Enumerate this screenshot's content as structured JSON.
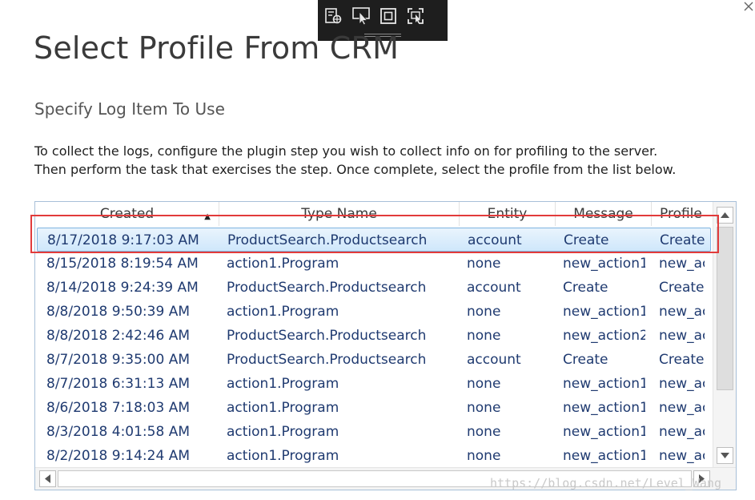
{
  "dialog": {
    "title": "Select Profile From CRM",
    "subtitle": "Specify Log Item To Use",
    "instructions": [
      "To collect the logs, configure the plugin step you wish to collect info on for profiling to the server.",
      "Then perform the task that exercises the step. Once complete, select the profile from the list below."
    ]
  },
  "toolbar": {
    "icons": [
      "select-element-icon",
      "pointer-icon",
      "frame-icon",
      "region-capture-icon"
    ]
  },
  "table": {
    "columns": [
      "Created",
      "Type Name",
      "Entity",
      "Message",
      "Profile"
    ],
    "sort": {
      "column": "Created",
      "direction": "ascending-arrow"
    },
    "selected_row": 0,
    "rows": [
      [
        "8/17/2018 9:17:03 AM",
        "ProductSearch.Productsearch",
        "account",
        "Create",
        "Create"
      ],
      [
        "8/15/2018 8:19:54 AM",
        "action1.Program",
        "none",
        "new_action1",
        "new_ac"
      ],
      [
        "8/14/2018 9:24:39 AM",
        "ProductSearch.Productsearch",
        "account",
        "Create",
        "Create"
      ],
      [
        "8/8/2018 9:50:39 AM",
        "action1.Program",
        "none",
        "new_action1",
        "new_ac"
      ],
      [
        "8/8/2018 2:42:46 AM",
        "ProductSearch.Productsearch",
        "none",
        "new_action2",
        "new_ac"
      ],
      [
        "8/7/2018 9:35:00 AM",
        "ProductSearch.Productsearch",
        "account",
        "Create",
        "Create"
      ],
      [
        "8/7/2018 6:31:13 AM",
        "action1.Program",
        "none",
        "new_action1",
        "new_ac"
      ],
      [
        "8/6/2018 7:18:03 AM",
        "action1.Program",
        "none",
        "new_action1",
        "new_ac"
      ],
      [
        "8/3/2018 4:01:58 AM",
        "action1.Program",
        "none",
        "new_action1",
        "new_ac"
      ],
      [
        "8/2/2018 9:14:24 AM",
        "action1.Program",
        "none",
        "new_action1",
        "new_ac"
      ]
    ]
  },
  "watermark": "https://blog.csdn.net/Level_Wang",
  "colors": {
    "accent": "#e23b3b",
    "row_text": "#1f3a70",
    "selection": "#cfe7fb"
  }
}
